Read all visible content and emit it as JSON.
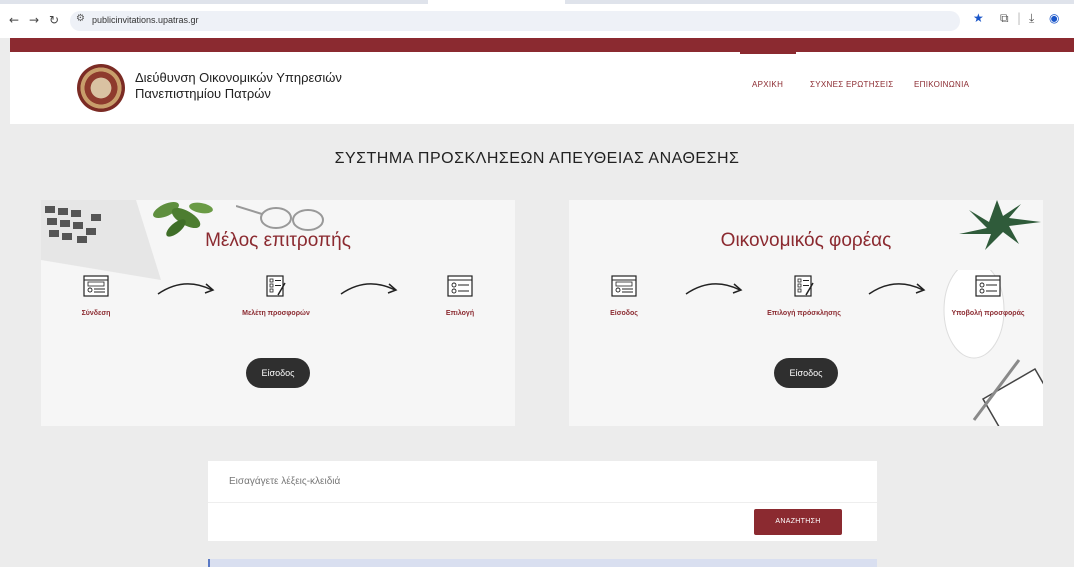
{
  "browser": {
    "url": "publicinvitations.upatras.gr",
    "back_icon": "arrow-left-icon",
    "forward_icon": "arrow-right-icon",
    "reload_icon": "reload-icon"
  },
  "site": {
    "title_line1": "Διεύθυνση Οικονομικών Υπηρεσιών",
    "title_line2": "Πανεπιστημίου Πατρών",
    "menu": [
      "ΑΡΧΙΚΗ",
      "ΣΥΧΝΕΣ ΕΡΩΤΗΣΕΙΣ",
      "ΕΠΙΚΟΙΝΩΝΙΑ"
    ],
    "accent": "#8b2a30"
  },
  "page": {
    "title": "ΣΥΣΤΗΜΑ ΠΡΟΣΚΛΗΣΕΩΝ ΑΠΕΥΘΕΙΑΣ ΑΝΑΘΕΣΗΣ"
  },
  "cards": [
    {
      "title": "Μέλος επιτροπής",
      "steps": [
        "Σύνδεση",
        "Μελέτη προσφορών",
        "Επιλογή"
      ],
      "button": "Είσοδος"
    },
    {
      "title": "Οικονομικός φορέας",
      "steps": [
        "Είσοδος",
        "Επιλογή πρόσκλησης",
        "Υποβολή προσφοράς"
      ],
      "button": "Είσοδος"
    }
  ],
  "search": {
    "placeholder": "Εισαγάγετε λέξεις-κλειδιά",
    "button": "ΑΝΑΖΗΤΗΣΗ"
  }
}
